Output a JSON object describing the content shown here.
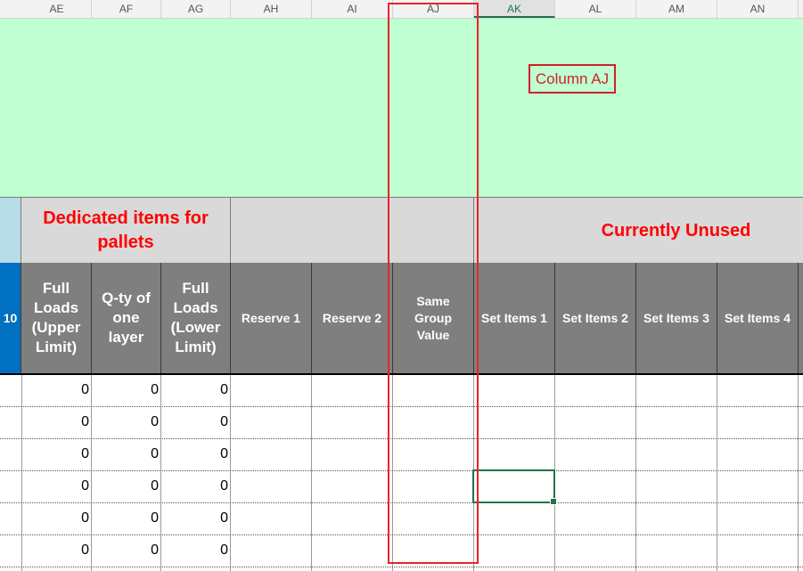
{
  "column_headers": [
    "AE",
    "AF",
    "AG",
    "AH",
    "AI",
    "AJ",
    "AK",
    "AL",
    "AM",
    "AN"
  ],
  "selected_column": "AK",
  "callout_label": "Column AJ",
  "band": {
    "dedicated_title": "Dedicated items for pallets",
    "unused_title": "Currently Unused"
  },
  "headers": {
    "partial_left": "10",
    "full_loads_upper": "Full Loads (Upper Limit)",
    "qty_one_layer": "Q-ty of one layer",
    "full_loads_lower": "Full Loads (Lower Limit)",
    "reserve1": "Reserve 1",
    "reserve2": "Reserve 2",
    "same_group_value": "Same Group Value",
    "set_items_1": "Set Items 1",
    "set_items_2": "Set Items 2",
    "set_items_3": "Set Items 3",
    "set_items_4": "Set Items 4"
  },
  "rows": [
    {
      "ae": "0",
      "af": "0",
      "ag": "0"
    },
    {
      "ae": "0",
      "af": "0",
      "ag": "0"
    },
    {
      "ae": "0",
      "af": "0",
      "ag": "0"
    },
    {
      "ae": "0",
      "af": "0",
      "ag": "0"
    },
    {
      "ae": "0",
      "af": "0",
      "ag": "0"
    },
    {
      "ae": "0",
      "af": "0",
      "ag": "0"
    }
  ],
  "colors": {
    "header_bg": "#7f7f7f",
    "band_bg": "#d9d9d9",
    "green_bg": "#bfffd2",
    "accent_red": "#ff0000",
    "excel_green": "#217346",
    "blue_header": "#0070c0"
  }
}
